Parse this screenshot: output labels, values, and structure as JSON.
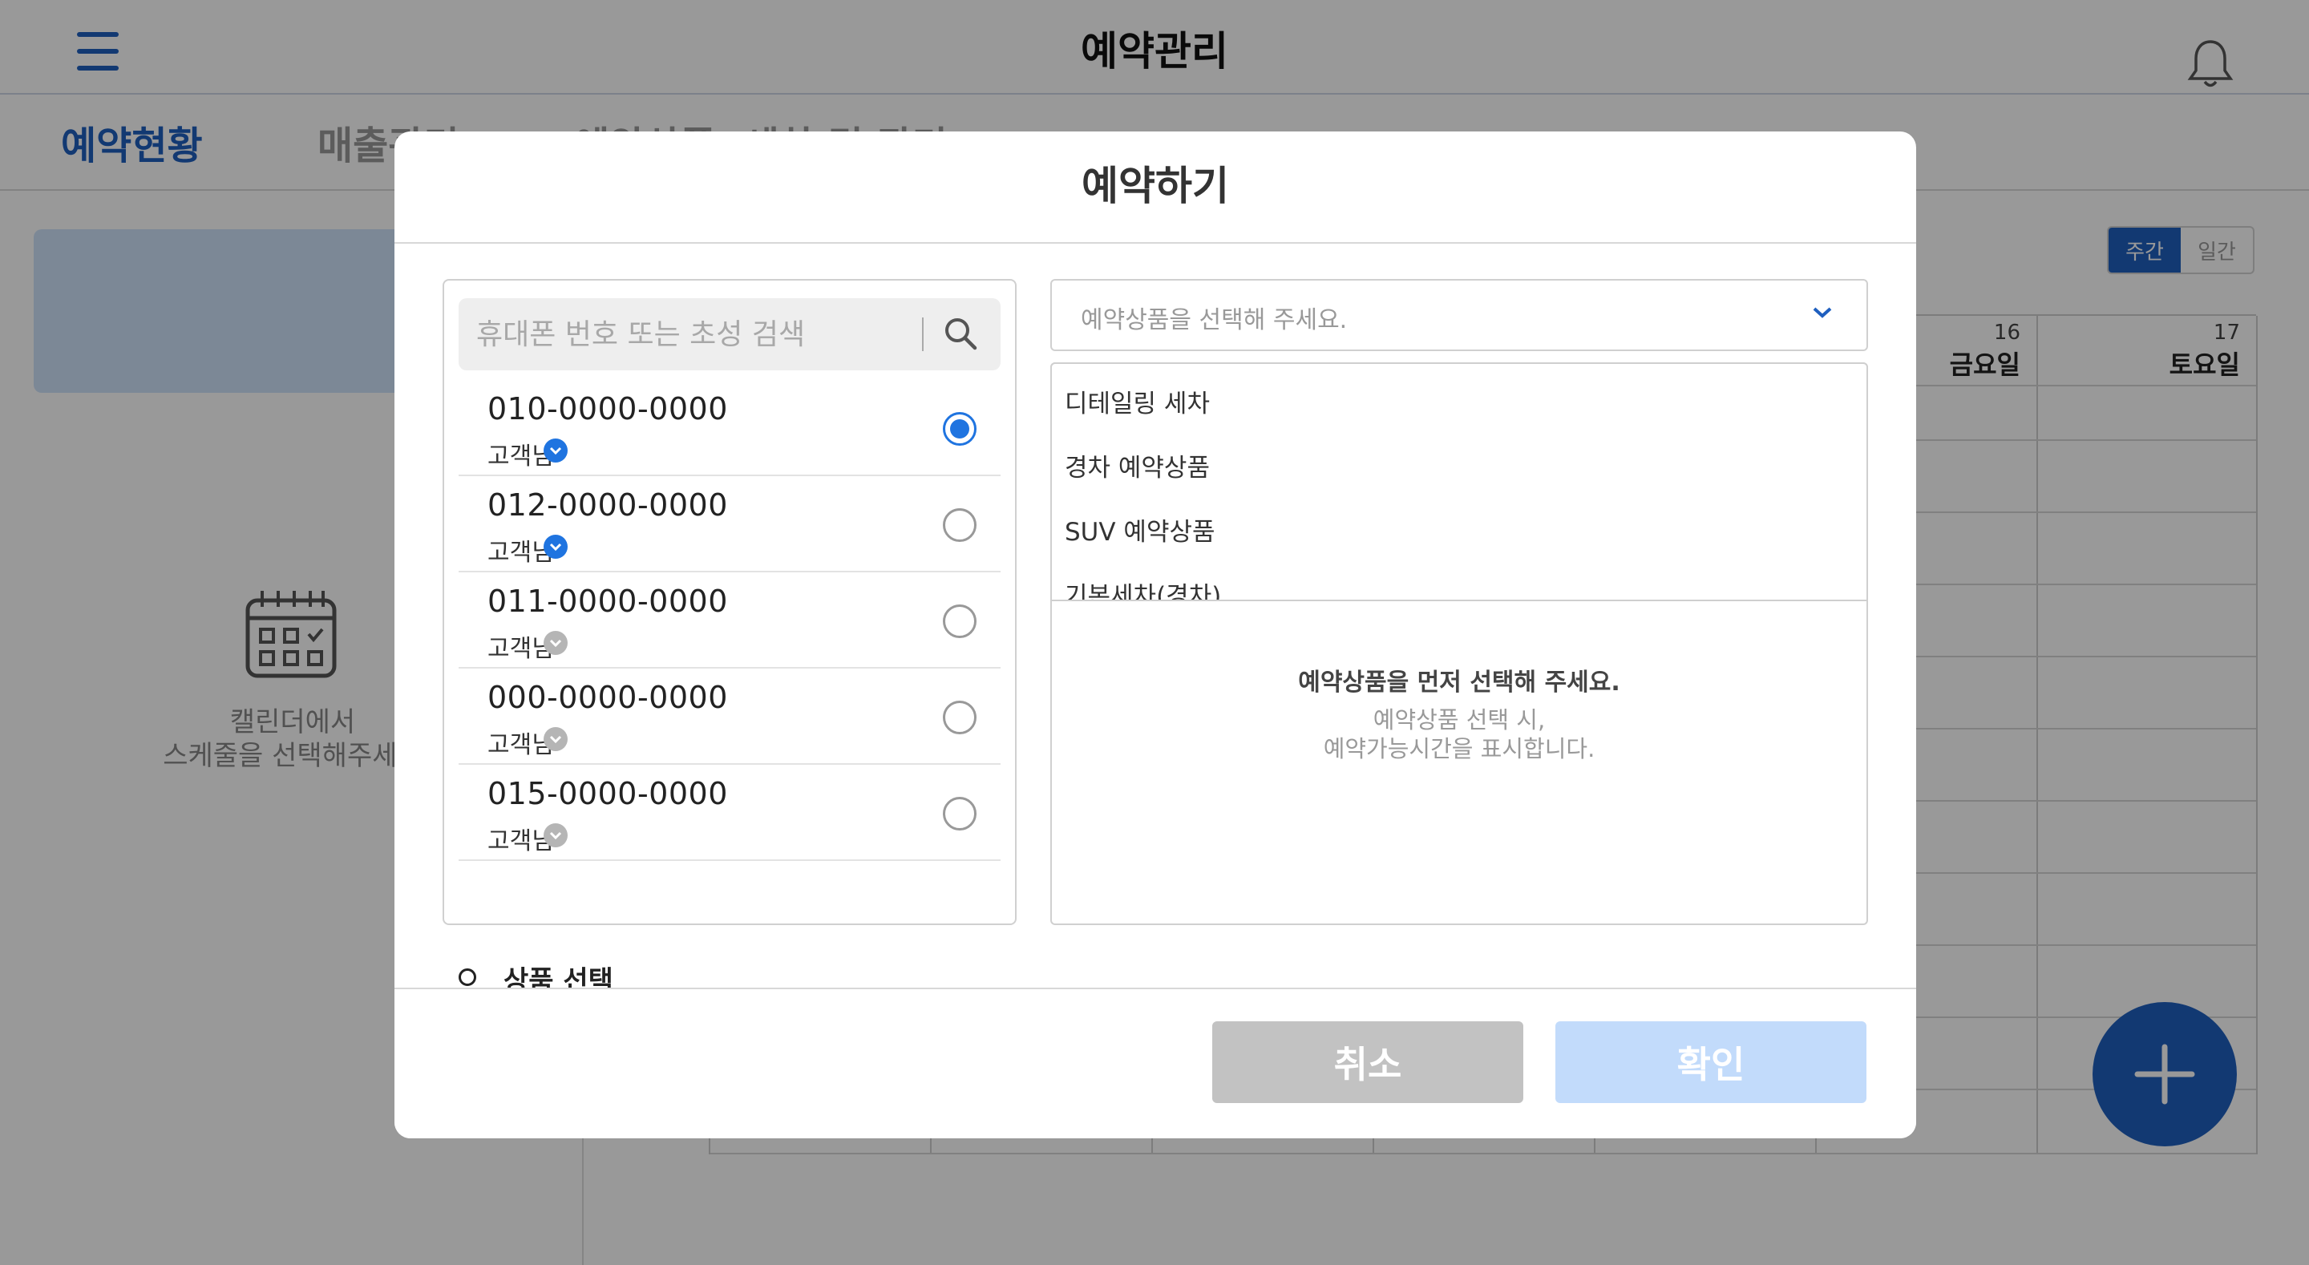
{
  "header": {
    "title": "예약관리"
  },
  "tabs": [
    "예약현황",
    "매출관리",
    "예약상품, 세차 및 관리"
  ],
  "left_panel": {
    "empty_line1": "캘린더에서",
    "empty_line2": "스케줄을 선택해주세요"
  },
  "view_toggle": {
    "week": "주간",
    "day": "일간"
  },
  "calendar": {
    "days": [
      {
        "num": "16",
        "name": "금요일"
      },
      {
        "num": "17",
        "name": "토요일"
      }
    ]
  },
  "modal": {
    "title": "예약하기",
    "search_placeholder": "휴대폰 번호 또는 초성 검색",
    "customers": [
      {
        "phone": "010-0000-0000",
        "name": "고객님",
        "verified": true,
        "selected": true
      },
      {
        "phone": "012-0000-0000",
        "name": "고객님",
        "verified": true,
        "selected": false
      },
      {
        "phone": "011-0000-0000",
        "name": "고객님",
        "verified": false,
        "selected": false
      },
      {
        "phone": "000-0000-0000",
        "name": "고객님",
        "verified": false,
        "selected": false
      },
      {
        "phone": "015-0000-0000",
        "name": "고객님",
        "verified": false,
        "selected": false
      }
    ],
    "section_label": "상품 선택",
    "product_placeholder": "예약상품을 선택해 주세요.",
    "product_options": [
      "디테일링 세차",
      "경차 예약상품",
      "SUV 예약상품",
      "기본세차(경차)"
    ],
    "guide_title": "예약상품을 먼저 선택해 주세요.",
    "guide_line1": "예약상품 선택 시,",
    "guide_line2": "예약가능시간을 표시합니다.",
    "cancel_label": "취소",
    "confirm_label": "확인"
  },
  "colors": {
    "accent": "#1f5fbf",
    "radio_selected": "#1f74e0",
    "verified_badge": "#1f74e0",
    "unverified_badge": "#b5b5b5",
    "confirm_disabled": "#c2dbfb",
    "cancel": "#c2c2c2"
  }
}
